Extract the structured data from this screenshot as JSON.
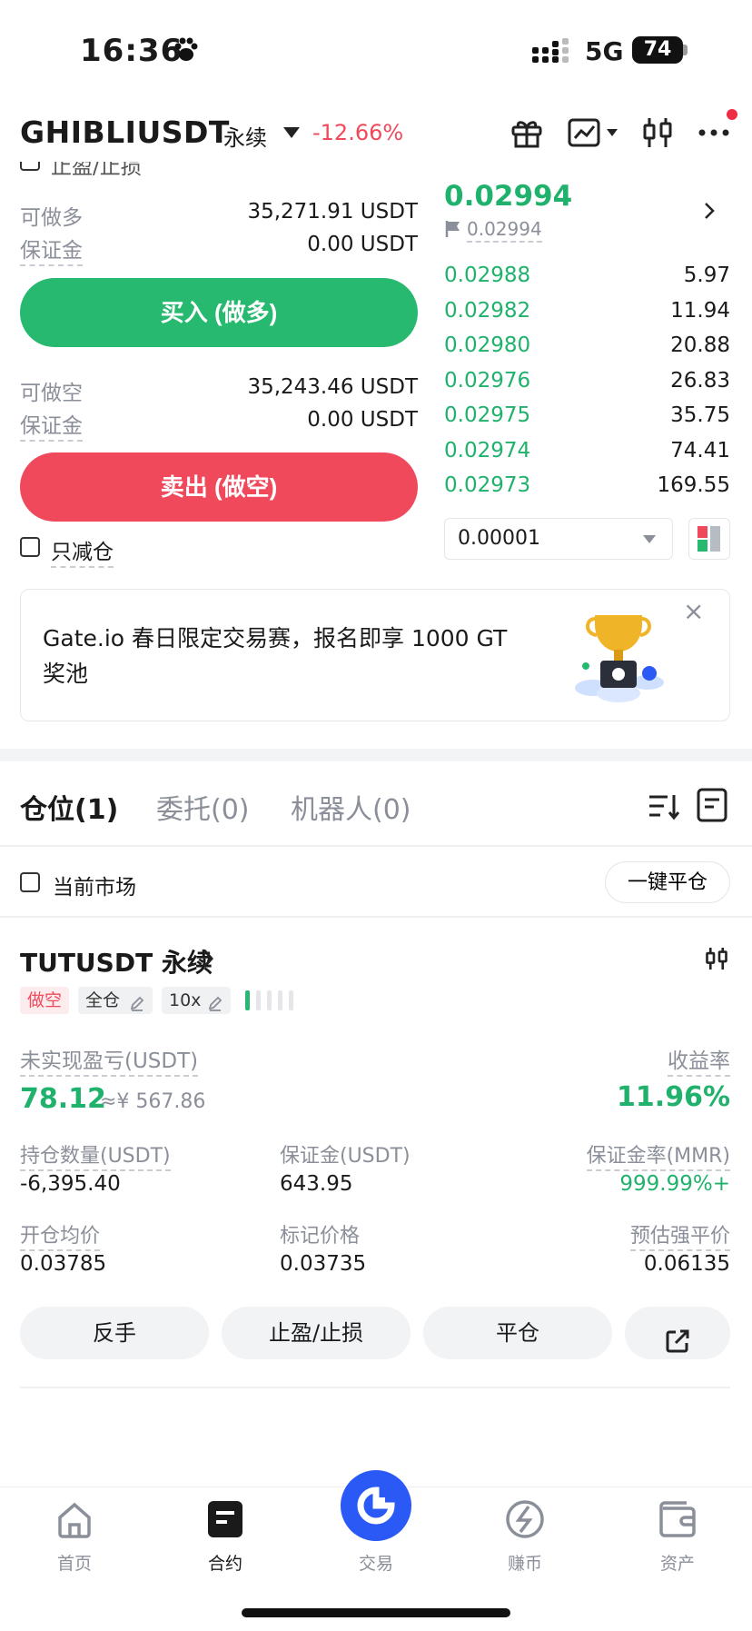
{
  "status_bar": {
    "time": "16:36",
    "network": "5G",
    "battery": "74"
  },
  "header": {
    "symbol": "GHIBLIUSDT",
    "contract_type": "永续",
    "change": "-12.66%"
  },
  "order_panel": {
    "tp_sl_label": "止盈/止损",
    "long_available_label": "可做多",
    "long_available_value": "35,271.91 USDT",
    "long_margin_label": "保证金",
    "long_margin_value": "0.00 USDT",
    "buy_button": "买入 (做多)",
    "short_available_label": "可做空",
    "short_available_value": "35,243.46 USDT",
    "short_margin_label": "保证金",
    "short_margin_value": "0.00 USDT",
    "sell_button": "卖出 (做空)",
    "reduce_only_label": "只减仓"
  },
  "orderbook": {
    "last_price": "0.02994",
    "mark_price": "0.02994",
    "bids": [
      {
        "price": "0.02988",
        "size": "5.97"
      },
      {
        "price": "0.02982",
        "size": "11.94"
      },
      {
        "price": "0.02980",
        "size": "20.88"
      },
      {
        "price": "0.02976",
        "size": "26.83"
      },
      {
        "price": "0.02975",
        "size": "35.75"
      },
      {
        "price": "0.02974",
        "size": "74.41"
      },
      {
        "price": "0.02973",
        "size": "169.55"
      }
    ],
    "tick_size": "0.00001"
  },
  "banner": {
    "text": "Gate.io 春日限定交易赛，报名即享 1000 GT 奖池",
    "close": "×"
  },
  "tabs": [
    {
      "label": "仓位(1)"
    },
    {
      "label": "委托(0)"
    },
    {
      "label": "机器人(0)"
    }
  ],
  "filter": {
    "current_market_label": "当前市场",
    "close_all_button": "一键平仓"
  },
  "position": {
    "title": "TUTUSDT 永续",
    "side_tag": "做空",
    "margin_mode_tag": "全仓",
    "leverage_tag": "10x",
    "pnl_label": "未实现盈亏(USDT)",
    "pnl_value": "78.12",
    "pnl_cny": "≈¥ 567.86",
    "roe_label": "收益率",
    "roe_value": "11.96%",
    "size_label": "持仓数量(USDT)",
    "size_value": "-6,395.40",
    "margin_label": "保证金(USDT)",
    "margin_value": "643.95",
    "mmr_label": "保证金率(MMR)",
    "mmr_value": "999.99%+",
    "entry_label": "开仓均价",
    "entry_value": "0.03785",
    "mark_label": "标记价格",
    "mark_value": "0.03735",
    "liq_label": "预估强平价",
    "liq_value": "0.06135",
    "actions": [
      "反手",
      "止盈/止损",
      "平仓"
    ]
  },
  "bottom_nav": [
    {
      "label": "首页",
      "icon": "home-icon"
    },
    {
      "label": "合约",
      "icon": "contract-icon"
    },
    {
      "label": "交易",
      "icon": "trade-icon"
    },
    {
      "label": "赚币",
      "icon": "earn-icon"
    },
    {
      "label": "资产",
      "icon": "wallet-icon"
    }
  ],
  "colors": {
    "green": "#20b26c",
    "red": "#ef4a5c",
    "blue": "#2a59f5"
  }
}
